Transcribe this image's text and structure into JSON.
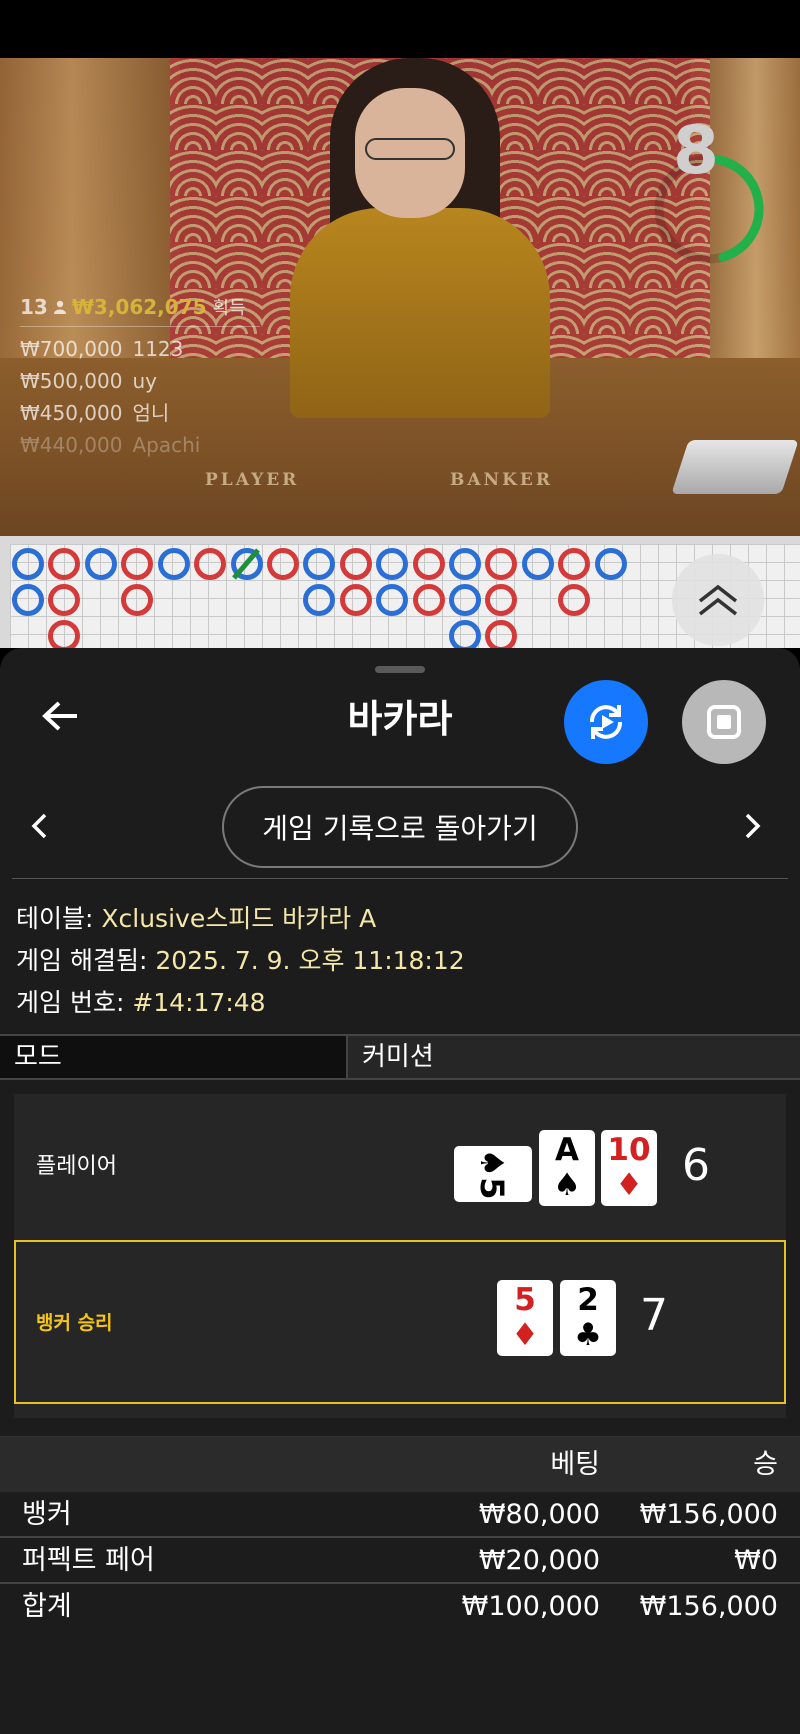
{
  "timer": {
    "value": "8"
  },
  "winners": {
    "count": "13",
    "amount": "₩3,062,075",
    "label": "획득",
    "rows": [
      {
        "amount": "₩700,000",
        "name": "1123"
      },
      {
        "amount": "₩500,000",
        "name": "uy"
      },
      {
        "amount": "₩450,000",
        "name": "엄니"
      },
      {
        "amount": "₩440,000",
        "name": "Apachi"
      }
    ]
  },
  "table_labels": {
    "player": "PLAYER",
    "banker": "BANKER"
  },
  "header": {
    "title": "바카라"
  },
  "history_button": "게임 기록으로 돌아가기",
  "info": {
    "table_label": "테이블:",
    "table_value": "Xclusive스피드 바카라 A",
    "resolved_label": "게임 해결됨:",
    "resolved_value": "2025. 7. 9. 오후 11:18:12",
    "number_label": "게임 번호:",
    "number_value": "#14:17:48"
  },
  "tabs": {
    "mode": "모드",
    "commission": "커미션"
  },
  "result": {
    "player": {
      "label": "플레이어",
      "score": "6",
      "cards": [
        {
          "rank": "5",
          "suit": "♠",
          "color": "#000000",
          "sideways": true
        },
        {
          "rank": "A",
          "suit": "♠",
          "color": "#000000"
        },
        {
          "rank": "10",
          "suit": "♦",
          "color": "#d32020"
        }
      ]
    },
    "banker": {
      "label": "뱅커 승리",
      "score": "7",
      "cards": [
        {
          "rank": "5",
          "suit": "♦",
          "color": "#d32020"
        },
        {
          "rank": "2",
          "suit": "♣",
          "color": "#000000"
        }
      ]
    }
  },
  "bets": {
    "headers": {
      "bet": "베팅",
      "win": "승"
    },
    "rows": [
      {
        "name": "뱅커",
        "bet": "₩80,000",
        "win": "₩156,000"
      },
      {
        "name": "퍼펙트 페어",
        "bet": "₩20,000",
        "win": "₩0"
      },
      {
        "name": "합계",
        "bet": "₩100,000",
        "win": "₩156,000"
      }
    ]
  },
  "colors": {
    "accent_blue": "#1677ff",
    "gold": "#d6b43c",
    "banker_highlight": "#e6c027",
    "player_bead": "#2b6fd6",
    "banker_bead": "#d43a3a",
    "timer_green": "#22b04a"
  },
  "icons": {
    "back": "arrow-left-icon",
    "replay": "replay-icon",
    "stop": "stop-icon",
    "prev": "chevron-left-icon",
    "next": "chevron-right-icon",
    "expand": "double-chevron-up-icon",
    "user": "user-icon"
  }
}
